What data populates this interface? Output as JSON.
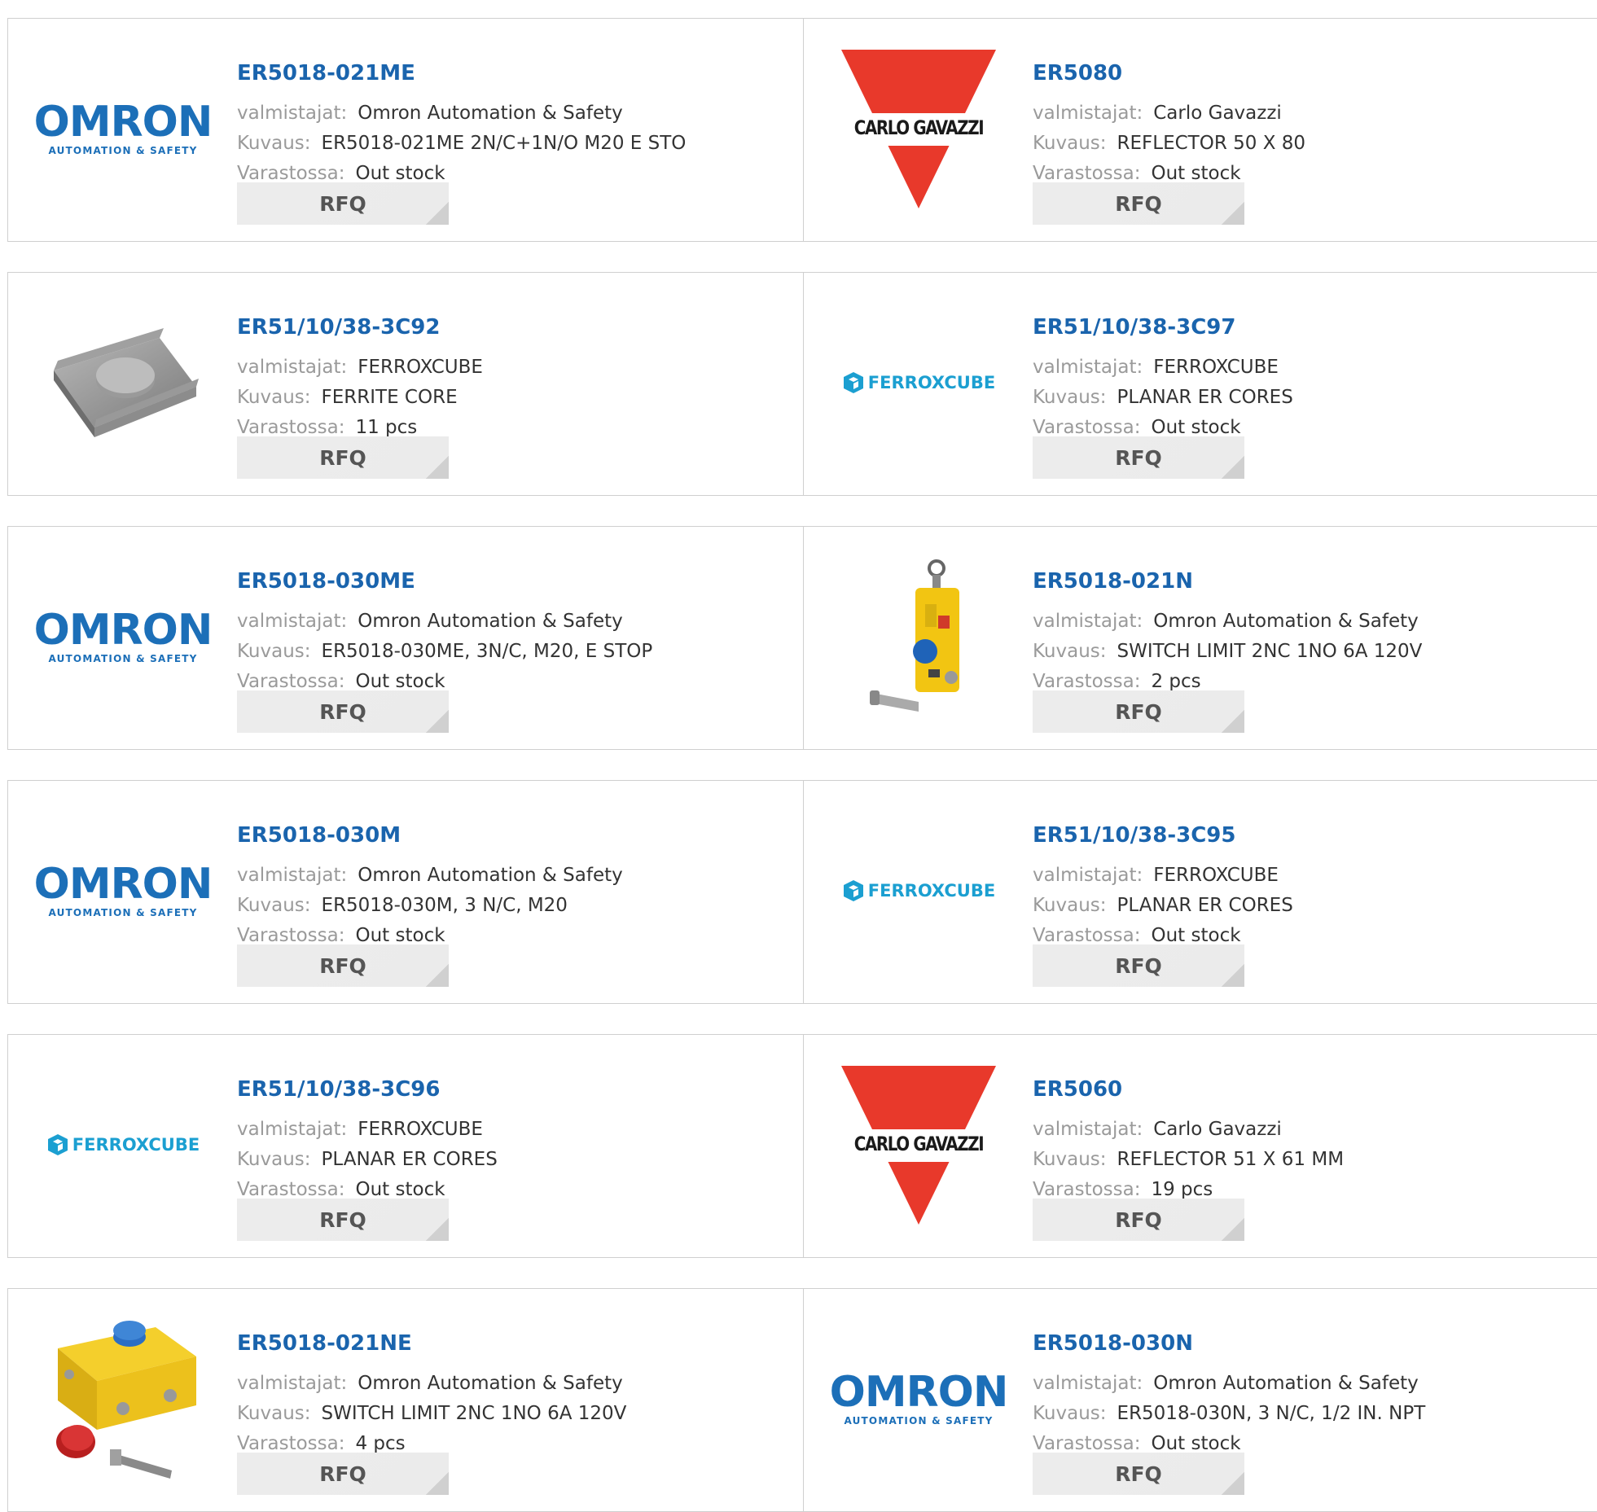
{
  "labels": {
    "manufacturer": "valmistajat:",
    "description": "Kuvaus:",
    "stock": "Varastossa:",
    "rfq": "RFQ"
  },
  "products": [
    {
      "part_number": "ER5018-021ME",
      "manufacturer": "Omron Automation & Safety",
      "description": "ER5018-021ME 2N/C+1N/O M20 E STO",
      "stock": "Out stock",
      "image": "omron-logo",
      "logo_text": "OMRON",
      "logo_sub": "AUTOMATION & SAFETY"
    },
    {
      "part_number": "ER5080",
      "manufacturer": "Carlo Gavazzi",
      "description": "REFLECTOR 50 X 80",
      "stock": "Out stock",
      "image": "carlo-gavazzi-logo",
      "logo_text": "CARLO GAVAZZI"
    },
    {
      "part_number": "ER51/10/38-3C92",
      "manufacturer": "FERROXCUBE",
      "description": "FERRITE CORE",
      "stock": "11 pcs",
      "image": "ferrite-core-photo"
    },
    {
      "part_number": "ER51/10/38-3C97",
      "manufacturer": "FERROXCUBE",
      "description": "PLANAR ER CORES",
      "stock": "Out stock",
      "image": "ferroxcube-logo",
      "logo_text": "FERROXCUBE"
    },
    {
      "part_number": "ER5018-030ME",
      "manufacturer": "Omron Automation & Safety",
      "description": "ER5018-030ME, 3N/C, M20, E STOP",
      "stock": "Out stock",
      "image": "omron-logo",
      "logo_text": "OMRON",
      "logo_sub": "AUTOMATION & SAFETY"
    },
    {
      "part_number": "ER5018-021N",
      "manufacturer": "Omron Automation & Safety",
      "description": "SWITCH LIMIT 2NC 1NO 6A 120V",
      "stock": "2 pcs",
      "image": "rope-pull-switch-photo"
    },
    {
      "part_number": "ER5018-030M",
      "manufacturer": "Omron Automation & Safety",
      "description": "ER5018-030M, 3 N/C, M20",
      "stock": "Out stock",
      "image": "omron-logo",
      "logo_text": "OMRON",
      "logo_sub": "AUTOMATION & SAFETY"
    },
    {
      "part_number": "ER51/10/38-3C95",
      "manufacturer": "FERROXCUBE",
      "description": "PLANAR ER CORES",
      "stock": "Out stock",
      "image": "ferroxcube-logo",
      "logo_text": "FERROXCUBE"
    },
    {
      "part_number": "ER51/10/38-3C96",
      "manufacturer": "FERROXCUBE",
      "description": "PLANAR ER CORES",
      "stock": "Out stock",
      "image": "ferroxcube-logo",
      "logo_text": "FERROXCUBE"
    },
    {
      "part_number": "ER5060",
      "manufacturer": "Carlo Gavazzi",
      "description": "REFLECTOR 51 X 61 MM",
      "stock": "19 pcs",
      "image": "carlo-gavazzi-logo",
      "logo_text": "CARLO GAVAZZI"
    },
    {
      "part_number": "ER5018-021NE",
      "manufacturer": "Omron Automation & Safety",
      "description": "SWITCH LIMIT 2NC 1NO 6A 120V",
      "stock": "4 pcs",
      "image": "estop-switch-photo"
    },
    {
      "part_number": "ER5018-030N",
      "manufacturer": "Omron Automation & Safety",
      "description": "ER5018-030N, 3 N/C, 1/2 IN. NPT",
      "stock": "Out stock",
      "image": "omron-logo",
      "logo_text": "OMRON",
      "logo_sub": "AUTOMATION & SAFETY"
    }
  ],
  "colors": {
    "part_number": "#1a64ad",
    "omron_blue": "#1c6fb8",
    "ferroxcube_blue": "#1b9fd1",
    "gavazzi_red": "#e8392b",
    "label_gray": "#9a9a9a",
    "value_text": "#333333"
  }
}
